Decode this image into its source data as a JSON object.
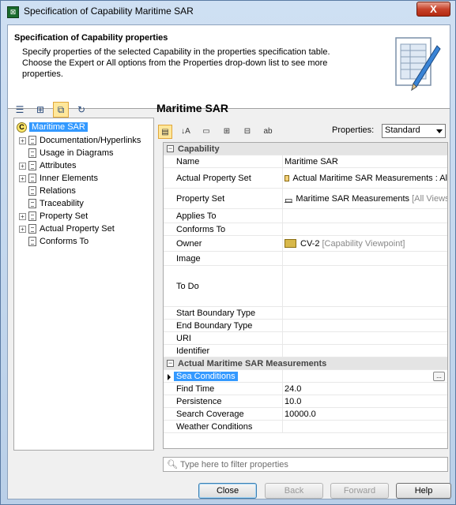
{
  "window": {
    "title": "Specification of Capability Maritime SAR",
    "close_label": "X"
  },
  "header": {
    "title": "Specification of Capability properties",
    "description": "Specify properties of the selected Capability in the properties specification table. Choose the Expert or All options from the Properties drop-down list to see more properties."
  },
  "tree": {
    "root": {
      "icon": "C",
      "label": "Maritime SAR"
    },
    "items": [
      {
        "label": "Documentation/Hyperlinks",
        "expandable": true
      },
      {
        "label": "Usage in Diagrams",
        "expandable": false
      },
      {
        "label": "Attributes",
        "expandable": true
      },
      {
        "label": "Inner Elements",
        "expandable": true
      },
      {
        "label": "Relations",
        "expandable": false
      },
      {
        "label": "Traceability",
        "expandable": false
      },
      {
        "label": "Property Set",
        "expandable": true
      },
      {
        "label": "Actual Property Set",
        "expandable": true
      },
      {
        "label": "Conforms To",
        "expandable": false
      }
    ]
  },
  "panel": {
    "title": "Maritime SAR",
    "properties_label": "Properties:",
    "properties_value": "Standard"
  },
  "grid": {
    "section1": "Capability",
    "rows1": [
      {
        "name": "Name",
        "value": "Maritime SAR",
        "suffix": ""
      },
      {
        "name": "Actual Property Set",
        "value": "Actual Maritime SAR Measurements : Al",
        "suffix": ""
      },
      {
        "name": "Property Set",
        "value": "Maritime SAR Measurements",
        "suffix": "[All Views"
      },
      {
        "name": "Applies To",
        "value": "",
        "suffix": ""
      },
      {
        "name": "Conforms To",
        "value": "",
        "suffix": ""
      },
      {
        "name": "Owner",
        "value": "CV-2",
        "suffix": "[Capability Viewpoint]"
      },
      {
        "name": "Image",
        "value": "",
        "suffix": ""
      },
      {
        "name": "To Do",
        "value": "",
        "suffix": ""
      },
      {
        "name": "Start Boundary Type",
        "value": "",
        "suffix": ""
      },
      {
        "name": "End Boundary Type",
        "value": "",
        "suffix": ""
      },
      {
        "name": "URI",
        "value": "",
        "suffix": ""
      },
      {
        "name": "Identifier",
        "value": "",
        "suffix": ""
      }
    ],
    "section2": "Actual Maritime SAR Measurements",
    "rows2": [
      {
        "name": "Sea Conditions",
        "value": "",
        "ellipsis": "..."
      },
      {
        "name": "Find Time",
        "value": "24.0"
      },
      {
        "name": "Persistence",
        "value": "10.0"
      },
      {
        "name": "Search Coverage",
        "value": "10000.0"
      },
      {
        "name": "Weather Conditions",
        "value": ""
      }
    ]
  },
  "filter": {
    "placeholder": "Type here to filter properties"
  },
  "buttons": {
    "close": "Close",
    "back": "Back",
    "forward": "Forward",
    "help": "Help"
  },
  "icons": {
    "app": "capability-app-icon",
    "tree_toolbar": [
      "list-view-icon",
      "hierarchy-view-icon",
      "copy-icon",
      "refresh-icon"
    ],
    "prop_toolbar": [
      "categorized-icon",
      "sort-alpha-icon",
      "collapse-icon",
      "expand-all-icon",
      "collapse-all-icon",
      "abc-icon"
    ]
  }
}
